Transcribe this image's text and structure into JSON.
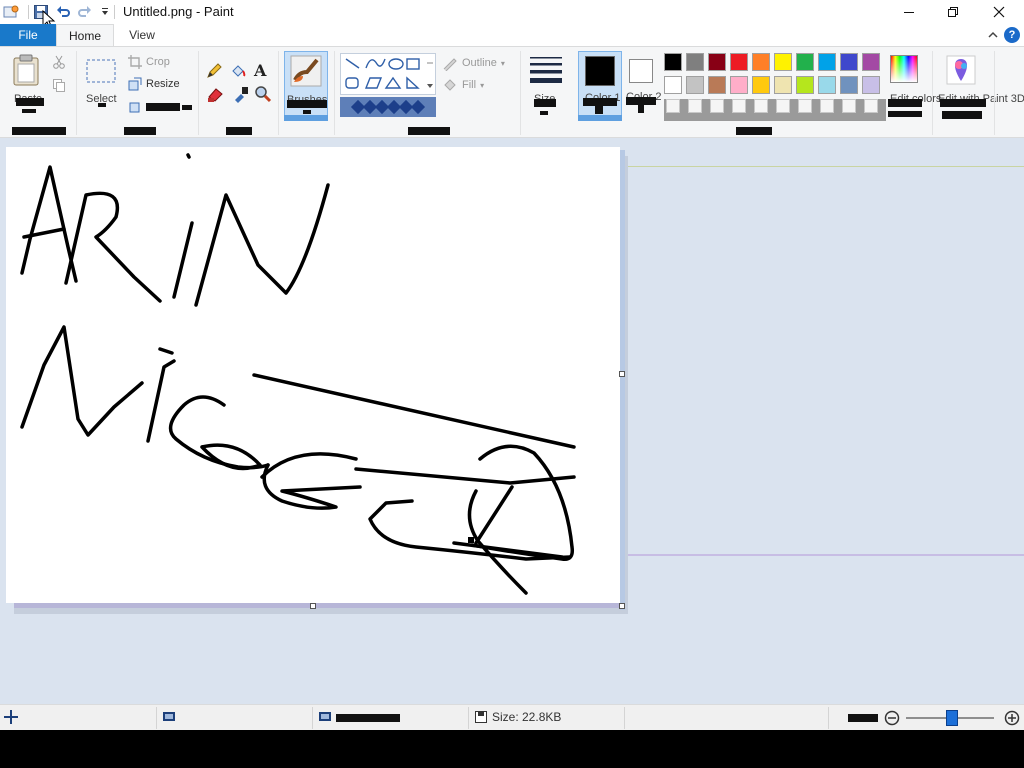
{
  "window": {
    "title": "Untitled.png - Paint",
    "minimize_glyph": "—",
    "maximize_glyph": "❐",
    "close_glyph": "✕"
  },
  "tabs": {
    "file": "File",
    "home": "Home",
    "view": "View"
  },
  "ribbon": {
    "clipboard": {
      "paste_label": "Paste"
    },
    "image": {
      "select_label": "Select",
      "crop_label": "Crop",
      "resize_label": "Resize"
    },
    "tools": {},
    "brushes": {
      "label": "Brushes"
    },
    "shapes": {
      "outline_label": "Outline",
      "fill_label": "Fill"
    },
    "size": {
      "label": "Size"
    },
    "color1": {
      "label": "Color 1",
      "value": "#000000"
    },
    "color2": {
      "label": "Color 2",
      "value": "#ffffff"
    },
    "edit_colors": {
      "label": "Edit colors"
    },
    "edit_paint3d": {
      "label": "Edit with Paint 3D"
    },
    "palette_row1": [
      "#000000",
      "#7f7f7f",
      "#880015",
      "#ed1c24",
      "#ff7f27",
      "#fff200",
      "#22b14c",
      "#00a2e8",
      "#3f48cc",
      "#a349a4"
    ],
    "palette_row2": [
      "#ffffff",
      "#c3c3c3",
      "#b97a57",
      "#ffaec9",
      "#ffc90e",
      "#efe4b0",
      "#b5e61d",
      "#99d9ea",
      "#7092be",
      "#c8bfe7"
    ],
    "help_glyph": "?"
  },
  "canvas": {
    "drawing": "handwritten text and scribbles"
  },
  "status": {
    "size_text": "Size: 22.8KB"
  }
}
